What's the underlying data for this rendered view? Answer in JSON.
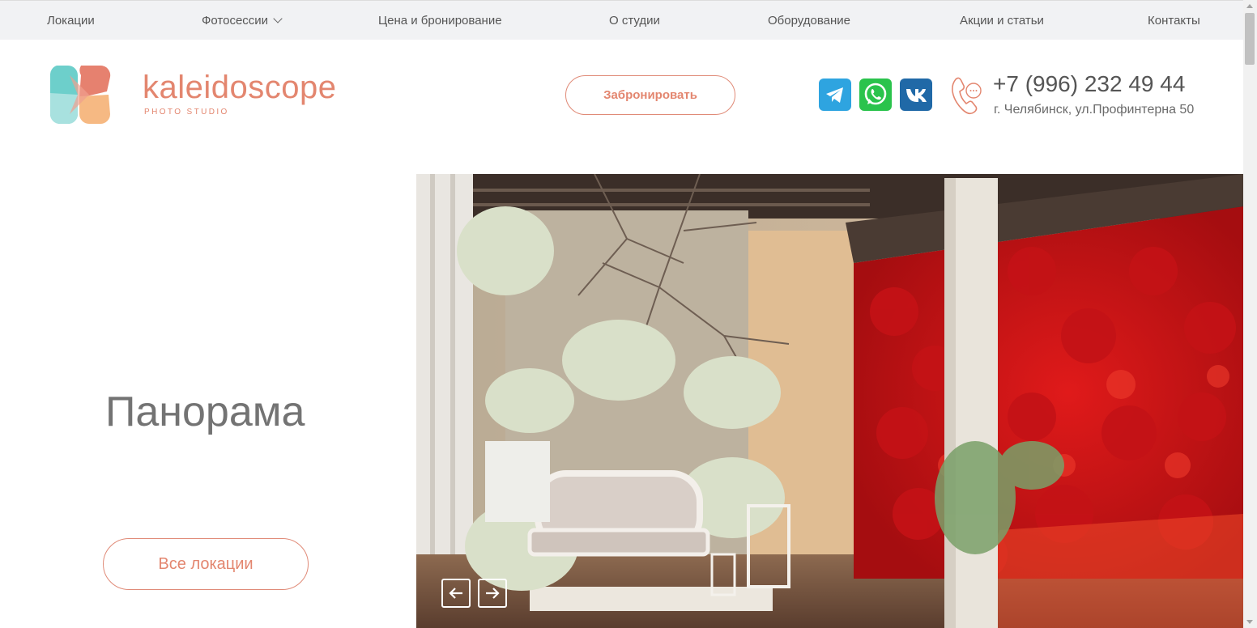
{
  "topnav": {
    "items": [
      "Локации",
      "Фотосессии",
      "Цена и бронирование",
      "О студии",
      "Оборудование",
      "Акции и статьи",
      "Контакты"
    ]
  },
  "header": {
    "logo_name": "kaleidoscope",
    "logo_sub": "PHOTO STUDIO",
    "book_label": "Забронировать",
    "social": [
      "telegram-icon",
      "whatsapp-icon",
      "vk-icon"
    ],
    "phone": "+7 (996) 232 49 44",
    "address": "г. Челябинск, ул.Профинтерна 50"
  },
  "hero": {
    "title": "Панорама",
    "all_locations_label": "Все локации",
    "prev_icon": "arrow-left-icon",
    "next_icon": "arrow-right-icon"
  },
  "colors": {
    "accent": "#e3866f",
    "nav_bg": "#f1f2f4",
    "telegram": "#2ea4e0",
    "whatsapp": "#2ac34c",
    "vk": "#2069a7"
  }
}
